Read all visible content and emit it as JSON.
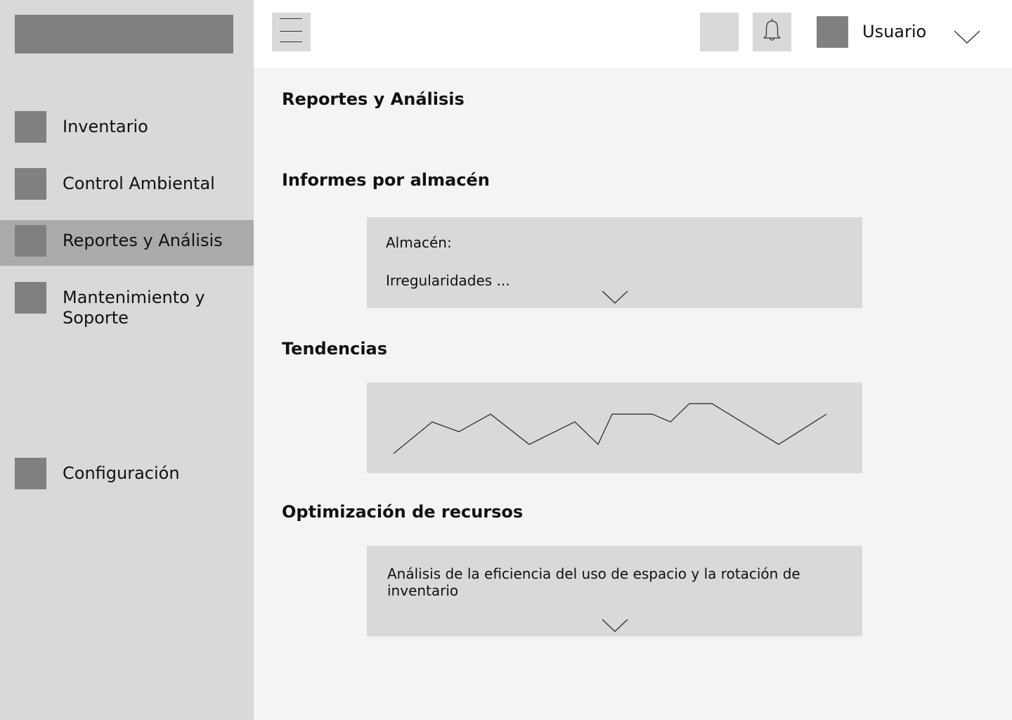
{
  "sidebar": {
    "items": [
      {
        "label": "Inventario",
        "icon": "square-icon",
        "active": false
      },
      {
        "label": "Control Ambiental",
        "icon": "square-icon",
        "active": false
      },
      {
        "label": "Reportes y Análisis",
        "icon": "square-icon",
        "active": true
      },
      {
        "label": "Mantenimiento y Soporte",
        "icon": "square-icon",
        "active": false
      },
      {
        "label": "Configuración",
        "icon": "square-icon",
        "active": false
      }
    ]
  },
  "header": {
    "user_label": "Usuario"
  },
  "main": {
    "page_title": "Reportes y Análisis",
    "sections": {
      "warehouse_reports": {
        "title": "Informes por almacén",
        "warehouse_label": "Almacén:",
        "irregularities_label": "Irregularidades ..."
      },
      "trends": {
        "title": "Tendencias"
      },
      "optimization": {
        "title": "Optimización de recursos",
        "description": "Análisis de la eficiencia del uso de espacio y la rotación de inventario"
      }
    }
  },
  "colors": {
    "sidebar_bg": "#d9d9d9",
    "active_item_bg": "#ababab",
    "placeholder_box": "#808080",
    "content_bg": "#f4f4f4",
    "card_bg": "#d9d9d9"
  }
}
